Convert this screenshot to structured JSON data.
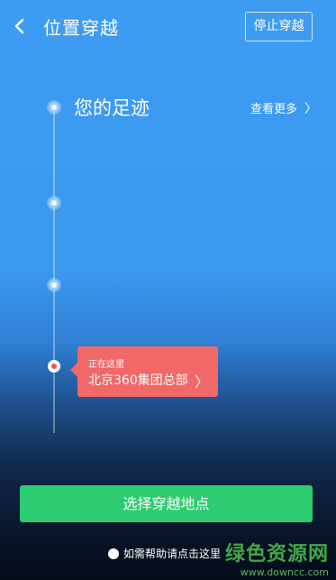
{
  "header": {
    "title": "位置穿越",
    "stop_button": "停止穿越"
  },
  "footprints": {
    "title": "您的足迹",
    "more_label": "查看更多",
    "more_chevron": "〉"
  },
  "current_location": {
    "status": "正在这里",
    "name": "北京360集团总部",
    "chevron": "〉"
  },
  "actions": {
    "choose_location": "选择穿越地点",
    "help": "如需帮助请点击这里"
  },
  "watermark": {
    "brand": "绿色资源网",
    "url": "www.downcc.com"
  },
  "colors": {
    "background_top": "#3d9cf2",
    "background_bottom": "#050c18",
    "callout": "#f06868",
    "primary_button": "#2ecc71"
  }
}
